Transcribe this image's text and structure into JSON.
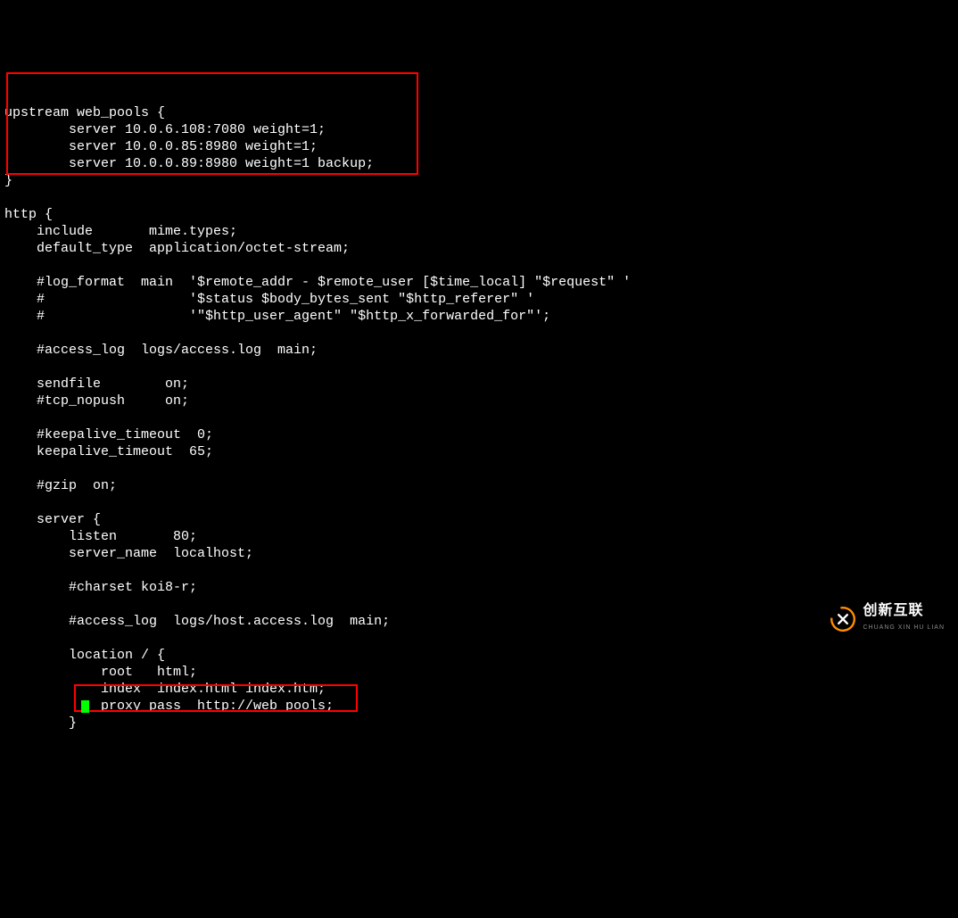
{
  "lines": [
    "upstream web_pools {",
    "        server 10.0.6.108:7080 weight=1;",
    "        server 10.0.0.85:8980 weight=1;",
    "        server 10.0.0.89:8980 weight=1 backup;",
    "}",
    "",
    "http {",
    "    include       mime.types;",
    "    default_type  application/octet-stream;",
    "",
    "    #log_format  main  '$remote_addr - $remote_user [$time_local] \"$request\" '",
    "    #                  '$status $body_bytes_sent \"$http_referer\" '",
    "    #                  '\"$http_user_agent\" \"$http_x_forwarded_for\"';",
    "",
    "    #access_log  logs/access.log  main;",
    "",
    "    sendfile        on;",
    "    #tcp_nopush     on;",
    "",
    "    #keepalive_timeout  0;",
    "    keepalive_timeout  65;",
    "",
    "    #gzip  on;",
    "",
    "    server {",
    "        listen       80;",
    "        server_name  localhost;",
    "",
    "        #charset koi8-r;",
    "",
    "        #access_log  logs/host.access.log  main;",
    "",
    "        location / {",
    "            root   html;",
    "            index  index.html index.htm;",
    "            proxy_pass  http://web_pools;",
    "        }"
  ],
  "logo": {
    "main": "创新互联",
    "sub": "CHUANG XIN HU LIAN"
  }
}
